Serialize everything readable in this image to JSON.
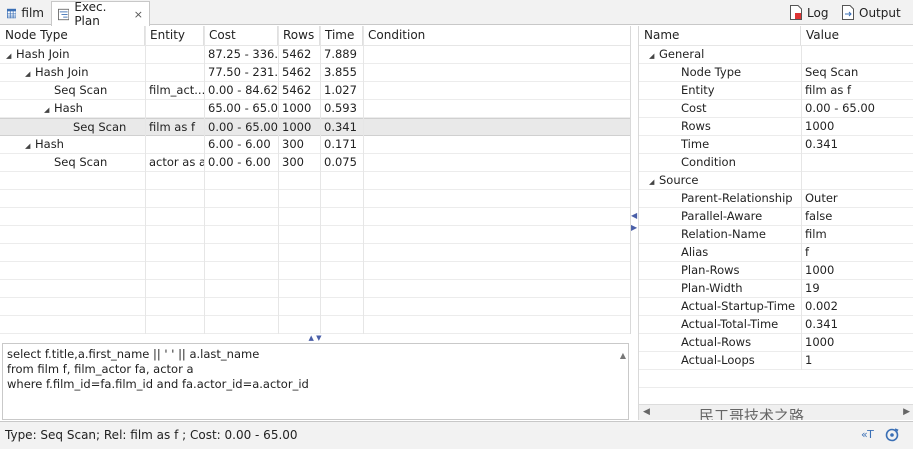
{
  "tabs": [
    {
      "label": "film",
      "icon": "table-icon"
    },
    {
      "label": "Exec. Plan",
      "icon": "exec-plan-icon",
      "close": "×"
    }
  ],
  "toolbar": {
    "log_label": "Log",
    "output_label": "Output"
  },
  "plan": {
    "columns": [
      "Node Type",
      "Entity",
      "Cost",
      "Rows",
      "Time",
      "Condition"
    ],
    "rows": [
      {
        "node": "Hash Join",
        "entity": "",
        "cost": "87.25 - 336...",
        "rows": "5462",
        "time": "7.889",
        "condition": "",
        "toggle": "◢"
      },
      {
        "node": "Hash Join",
        "entity": "",
        "cost": "77.50 - 231...",
        "rows": "5462",
        "time": "3.855",
        "condition": "",
        "toggle": "◢"
      },
      {
        "node": "Seq Scan",
        "entity": "film_act...",
        "cost": "0.00 - 84.62",
        "rows": "5462",
        "time": "1.027",
        "condition": "",
        "toggle": ""
      },
      {
        "node": "Hash",
        "entity": "",
        "cost": "65.00 - 65.00",
        "rows": "1000",
        "time": "0.593",
        "condition": "",
        "toggle": "◢"
      },
      {
        "node": "Seq Scan",
        "entity": "film as f",
        "cost": "0.00 - 65.00",
        "rows": "1000",
        "time": "0.341",
        "condition": "",
        "toggle": ""
      },
      {
        "node": "Hash",
        "entity": "",
        "cost": "6.00 - 6.00",
        "rows": "300",
        "time": "0.171",
        "condition": "",
        "toggle": "◢"
      },
      {
        "node": "Seq Scan",
        "entity": "actor as a",
        "cost": "0.00 - 6.00",
        "rows": "300",
        "time": "0.075",
        "condition": "",
        "toggle": ""
      }
    ]
  },
  "sql": {
    "lines": [
      "select f.title,a.first_name || ' ' || a.last_name",
      "from film f, film_actor fa, actor a",
      "where f.film_id=fa.film_id and fa.actor_id=a.actor_id"
    ]
  },
  "properties": {
    "columns": [
      "Name",
      "Value"
    ],
    "rows": [
      {
        "name": "General",
        "value": "",
        "group": true
      },
      {
        "name": "Node Type",
        "value": "Seq Scan"
      },
      {
        "name": "Entity",
        "value": "film as f"
      },
      {
        "name": "Cost",
        "value": "0.00 - 65.00"
      },
      {
        "name": "Rows",
        "value": "1000"
      },
      {
        "name": "Time",
        "value": "0.341"
      },
      {
        "name": "Condition",
        "value": ""
      },
      {
        "name": "Source",
        "value": "",
        "group": true
      },
      {
        "name": "Parent-Relationship",
        "value": "Outer"
      },
      {
        "name": "Parallel-Aware",
        "value": "false"
      },
      {
        "name": "Relation-Name",
        "value": "film"
      },
      {
        "name": "Alias",
        "value": "f"
      },
      {
        "name": "Plan-Rows",
        "value": "1000"
      },
      {
        "name": "Plan-Width",
        "value": "19"
      },
      {
        "name": "Actual-Startup-Time",
        "value": "0.002"
      },
      {
        "name": "Actual-Total-Time",
        "value": "0.341"
      },
      {
        "name": "Actual-Rows",
        "value": "1000"
      },
      {
        "name": "Actual-Loops",
        "value": "1"
      }
    ],
    "watermark": "民工哥技术之路"
  },
  "status": {
    "text": "Type: Seq Scan; Rel: film as f ; Cost: 0.00 - 65.00"
  },
  "colors": {
    "accent": "#3a6fb5",
    "selection": "#e9e9e9",
    "chrome": "#f2f2f2"
  }
}
